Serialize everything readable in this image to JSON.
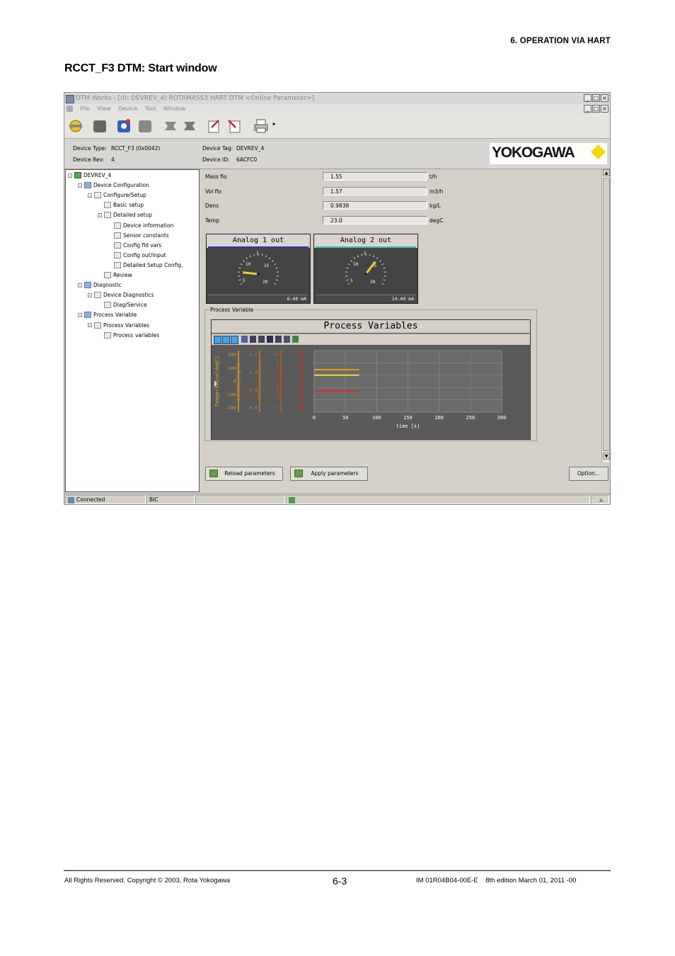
{
  "page": {
    "section_header": "6. OPERATION VIA HART",
    "title": "RCCT_F3 DTM: Start window"
  },
  "window": {
    "title": "DTM Works - [(0: DEVREV_4) ROTAMASS3 HART DTM <Online Parameter>]",
    "menu": [
      "File",
      "View",
      "Device",
      "Tool",
      "Window"
    ],
    "device_info": {
      "type_label": "Device Type:",
      "type_value": "RCCT_F3 (0x0042)",
      "rev_label": "Device Rev:",
      "rev_value": "4",
      "tag_label": "Device Tag:",
      "tag_value": "DEVREV_4",
      "id_label": "Device ID:",
      "id_value": "6ACFC0"
    },
    "logo_text": "YOKOGAWA",
    "tree": [
      {
        "label": "DEVREV_4",
        "level": 0,
        "icon": "device-icon"
      },
      {
        "label": "Device Configuration",
        "level": 1,
        "icon": "folder-icon"
      },
      {
        "label": "Configure/Setup",
        "level": 2,
        "icon": "page-icon"
      },
      {
        "label": "Basic setup",
        "level": 3,
        "icon": "page-icon"
      },
      {
        "label": "Detailed setup",
        "level": 3,
        "icon": "page-icon"
      },
      {
        "label": "Device information",
        "level": 4,
        "icon": "page-icon"
      },
      {
        "label": "Sensor constants",
        "level": 4,
        "icon": "page-icon"
      },
      {
        "label": "Config fld vars",
        "level": 4,
        "icon": "page-icon"
      },
      {
        "label": "Config out/input",
        "level": 4,
        "icon": "page-icon"
      },
      {
        "label": "Detailed Setup Config.",
        "level": 4,
        "icon": "page-icon"
      },
      {
        "label": "Review",
        "level": 3,
        "icon": "page-icon"
      },
      {
        "label": "Diagnostic",
        "level": 1,
        "icon": "folder-icon"
      },
      {
        "label": "Device Diagnostics",
        "level": 2,
        "icon": "page-icon"
      },
      {
        "label": "Diag/Service",
        "level": 3,
        "icon": "page-icon"
      },
      {
        "label": "Process Variable",
        "level": 1,
        "icon": "folder-icon"
      },
      {
        "label": "Process Variables",
        "level": 2,
        "icon": "page-icon"
      },
      {
        "label": "Process variables",
        "level": 3,
        "icon": "page-icon"
      }
    ],
    "params": [
      {
        "label": "Mass flo",
        "value": "1.55",
        "unit": "t/h"
      },
      {
        "label": "Vol flo",
        "value": "1.57",
        "unit": "m3/h"
      },
      {
        "label": "Dens",
        "value": "0.9838",
        "unit": "kg/L"
      },
      {
        "label": "Temp",
        "value": "23.0",
        "unit": "degC"
      }
    ],
    "gauges": [
      {
        "title": "Analog 1 out",
        "reading": "6.40 mA",
        "value_ma": 6.4,
        "accent": "#3030c0",
        "ticks": [
          "1",
          "10",
          "15",
          "5",
          "20"
        ]
      },
      {
        "title": "Analog 2 out",
        "reading": "14.49 mA",
        "value_ma": 14.49,
        "accent": "#30c0c0",
        "ticks": [
          "1",
          "10",
          "15",
          "5",
          "20"
        ]
      }
    ],
    "pv_group_label": "Process Variable",
    "chart_data": {
      "type": "line",
      "title": "Process Variables",
      "xlabel": "time [s]",
      "x_ticks": [
        0,
        50,
        100,
        150,
        200,
        250,
        300
      ],
      "xlim": [
        0,
        300
      ],
      "axes": [
        {
          "label": "Temperature[degC]",
          "ticks": [
            "200",
            "100",
            "0",
            "-100",
            "-200"
          ],
          "color": "#e0a020"
        },
        {
          "label": "Density[kg/L]",
          "ticks": [
            "1.5",
            "1.0",
            "0.5",
            "0.0"
          ],
          "color": "#d08020"
        },
        {
          "label": "Vflow [m3/h]",
          "ticks": [
            "10",
            "8",
            "6",
            "4",
            "2",
            "0"
          ],
          "color": "#c06010"
        },
        {
          "label": "Mflow [t/h]",
          "ticks": [
            "10",
            "8",
            "6",
            "4",
            "2",
            "0"
          ],
          "color": "#d03020"
        }
      ],
      "series": [
        {
          "x": [
            0,
            72
          ],
          "y_frac": [
            0.69,
            0.69
          ],
          "color": "#e89a20"
        },
        {
          "x": [
            0,
            72
          ],
          "y_frac": [
            0.6,
            0.6
          ],
          "color": "#f0e020"
        },
        {
          "x": [
            0,
            72
          ],
          "y_frac": [
            0.345,
            0.345
          ],
          "color": "#d03020"
        }
      ]
    },
    "buttons": {
      "reload": "Reload parameters",
      "apply": "Apply parameters",
      "option": "Option..."
    },
    "status": {
      "connected": "Connected",
      "mode": "BIC"
    }
  },
  "footer": {
    "copyright": "All Rights Reserved. Copyright © 2003, Rota Yokogawa",
    "page_number": "6-3",
    "doc_id": "IM 01R04B04-00E-E    8th edition March 01, 2011 -00"
  }
}
